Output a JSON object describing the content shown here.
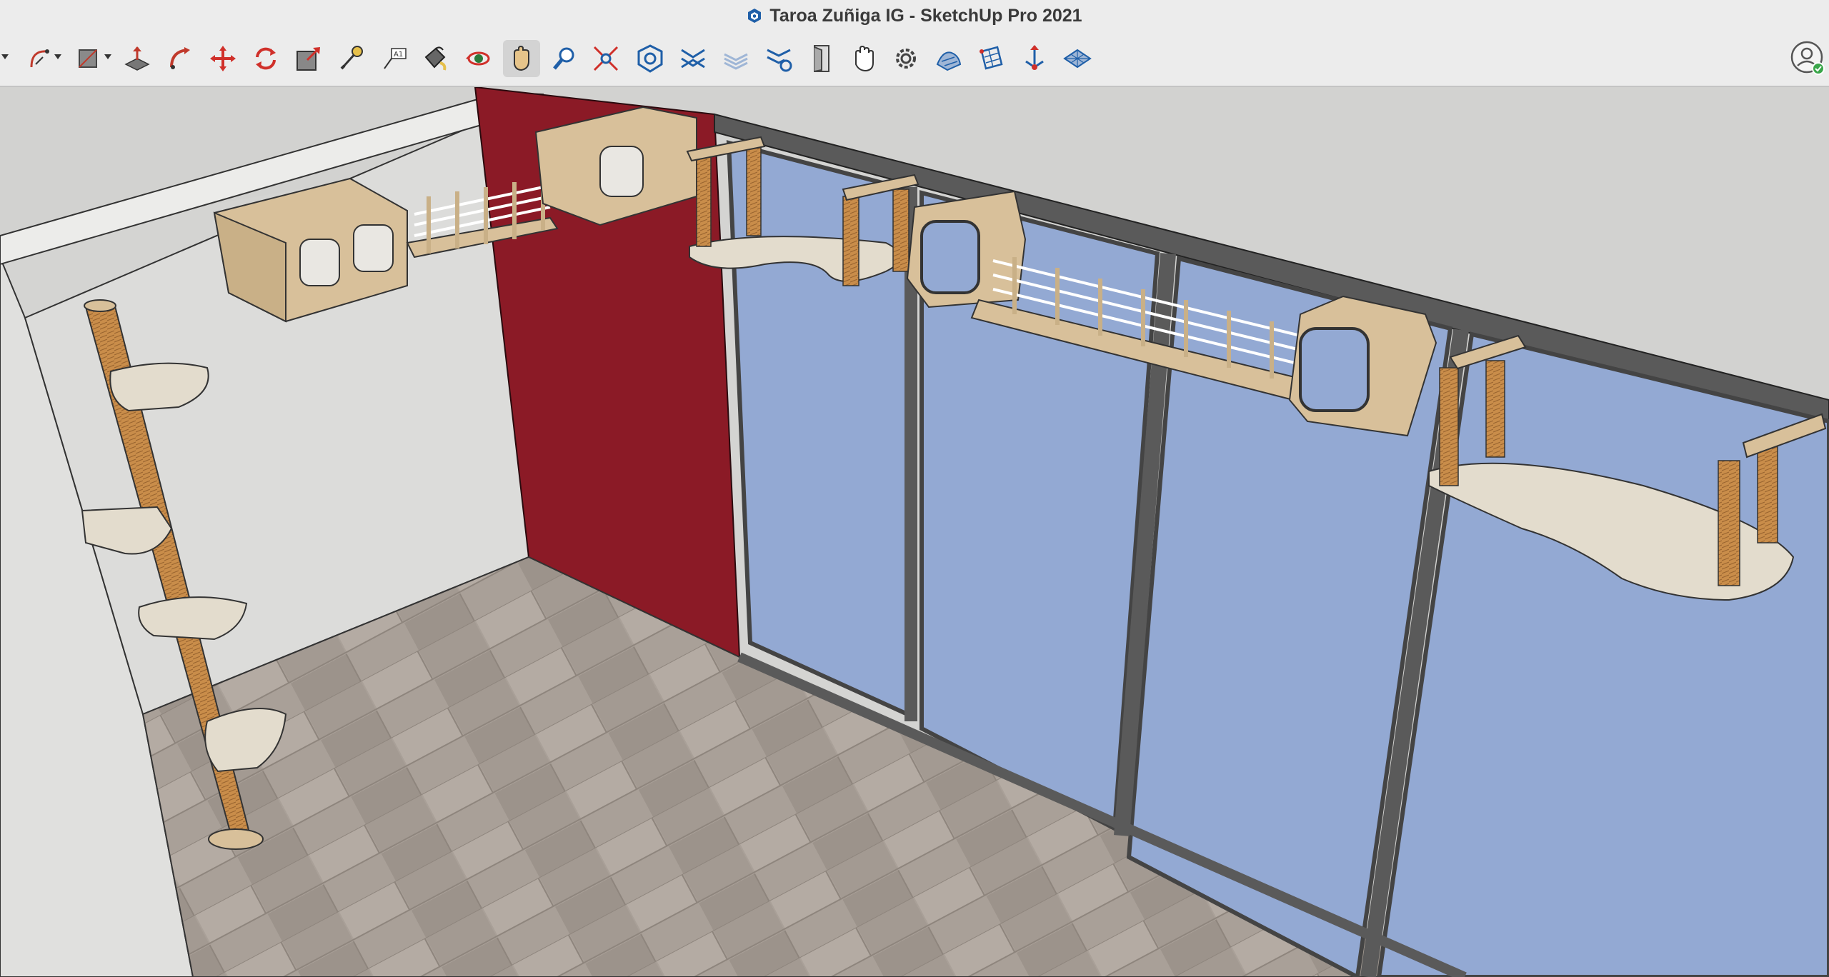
{
  "window": {
    "title": "Taroa Zuñiga IG - SketchUp Pro 2021",
    "app_icon": "sketchup-logo-icon"
  },
  "toolbar": {
    "tools": [
      {
        "icon": "select-dropdown-caret-icon"
      },
      {
        "icon": "arc-tool-icon"
      },
      {
        "icon": "shape-tool-icon"
      },
      {
        "icon": "push-pull-icon"
      },
      {
        "icon": "follow-me-icon"
      },
      {
        "icon": "move-icon"
      },
      {
        "icon": "rotate-icon"
      },
      {
        "icon": "scale-icon"
      },
      {
        "icon": "tape-measure-icon"
      },
      {
        "icon": "text-tool-icon"
      },
      {
        "icon": "paint-bucket-icon"
      },
      {
        "icon": "orbit-icon"
      },
      {
        "icon": "pan-icon",
        "active": true
      },
      {
        "icon": "zoom-icon"
      },
      {
        "icon": "zoom-extents-icon"
      },
      {
        "icon": "3d-warehouse-icon"
      },
      {
        "icon": "extension-warehouse-icon"
      },
      {
        "icon": "layout-icon"
      },
      {
        "icon": "extension-manager-icon"
      },
      {
        "icon": "door-icon"
      },
      {
        "icon": "hand-icon"
      },
      {
        "icon": "settings-gear-icon"
      },
      {
        "icon": "sandbox-from-contours-icon"
      },
      {
        "icon": "section-plane-icon"
      },
      {
        "icon": "axes-icon"
      },
      {
        "icon": "terrain-grid-icon"
      }
    ],
    "account_icon": "user-account-icon"
  },
  "colors": {
    "accent_wall": "#8b1a26",
    "window_glass": "#93a9d3",
    "frame": "#5a5a5a",
    "wood": "#d8c09a",
    "floor": "#a89f96",
    "wall": "#dcdcdc"
  }
}
